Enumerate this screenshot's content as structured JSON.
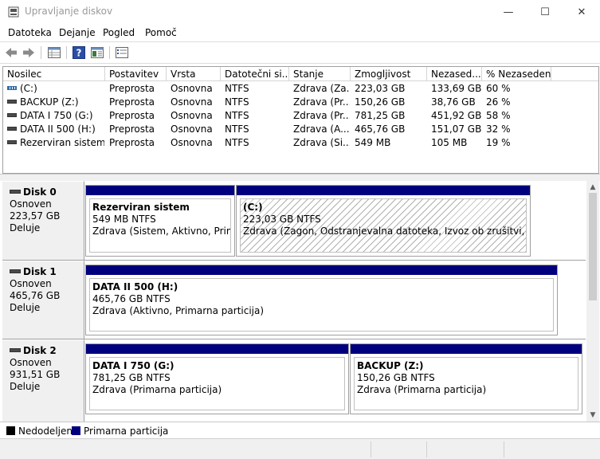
{
  "window": {
    "title": "Upravljanje diskov",
    "minimize_glyph": "—",
    "maximize_glyph": "☐",
    "close_glyph": "✕"
  },
  "menu": [
    "Datoteka",
    "Dejanje",
    "Pogled",
    "Pomoč"
  ],
  "toolbar": {
    "icons": [
      "back-arrow-icon",
      "forward-arrow-icon",
      "properties-grid-icon",
      "help-icon",
      "panel-icon",
      "list-icon"
    ],
    "help_glyph": "?"
  },
  "volume_list": {
    "headers": [
      "Nosilec",
      "Postavitev",
      "Vrsta",
      "Datotečni si...",
      "Stanje",
      "Zmogljivost",
      "Nezased...",
      "% Nezaseden..."
    ],
    "rows": [
      {
        "cells": [
          "(C:)",
          "Preprosta",
          "Osnovna",
          "NTFS",
          "Zdrava (Za...",
          "223,03 GB",
          "133,69 GB",
          "60 %"
        ],
        "icon": "striped"
      },
      {
        "cells": [
          "BACKUP (Z:)",
          "Preprosta",
          "Osnovna",
          "NTFS",
          "Zdrava (Pr...",
          "150,26 GB",
          "38,76 GB",
          "26 %"
        ],
        "icon": "plain"
      },
      {
        "cells": [
          "DATA I 750 (G:)",
          "Preprosta",
          "Osnovna",
          "NTFS",
          "Zdrava (Pr...",
          "781,25 GB",
          "451,92 GB",
          "58 %"
        ],
        "icon": "plain"
      },
      {
        "cells": [
          "DATA II 500 (H:)",
          "Preprosta",
          "Osnovna",
          "NTFS",
          "Zdrava (A...",
          "465,76 GB",
          "151,07 GB",
          "32 %"
        ],
        "icon": "plain"
      },
      {
        "cells": [
          "Rezerviran sistem",
          "Preprosta",
          "Osnovna",
          "NTFS",
          "Zdrava (Si...",
          "549 MB",
          "105 MB",
          "19 %"
        ],
        "icon": "plain"
      }
    ]
  },
  "disks": [
    {
      "name": "Disk 0",
      "type": "Osnoven",
      "size": "223,57 GB",
      "status": "Deluje",
      "partitions": [
        {
          "title": "Rezerviran sistem",
          "size": "549 MB NTFS",
          "status": "Zdrava (Sistem, Aktivno, Primarn",
          "hatched": false
        },
        {
          "title": "(C:)",
          "size": "223,03 GB NTFS",
          "status": "Zdrava (Zagon, Odstranjevalna datoteka, Izvoz ob zrušitvi, Primarna",
          "hatched": true
        }
      ]
    },
    {
      "name": "Disk 1",
      "type": "Osnoven",
      "size": "465,76 GB",
      "status": "Deluje",
      "partitions": [
        {
          "title": "DATA II 500  (H:)",
          "size": "465,76 GB NTFS",
          "status": "Zdrava (Aktivno, Primarna particija)",
          "hatched": false
        }
      ]
    },
    {
      "name": "Disk 2",
      "type": "Osnoven",
      "size": "931,51 GB",
      "status": "Deluje",
      "partitions": [
        {
          "title": "DATA I 750  (G:)",
          "size": "781,25 GB NTFS",
          "status": "Zdrava (Primarna particija)",
          "hatched": false
        },
        {
          "title": "BACKUP  (Z:)",
          "size": "150,26 GB NTFS",
          "status": "Zdrava (Primarna particija)",
          "hatched": false
        }
      ]
    }
  ],
  "legend": [
    {
      "label": "Nedodeljen",
      "color": "#000000"
    },
    {
      "label": "Primarna particija",
      "color": "#00007f"
    }
  ],
  "scroll": {
    "up_glyph": "▲",
    "down_glyph": "▼"
  }
}
